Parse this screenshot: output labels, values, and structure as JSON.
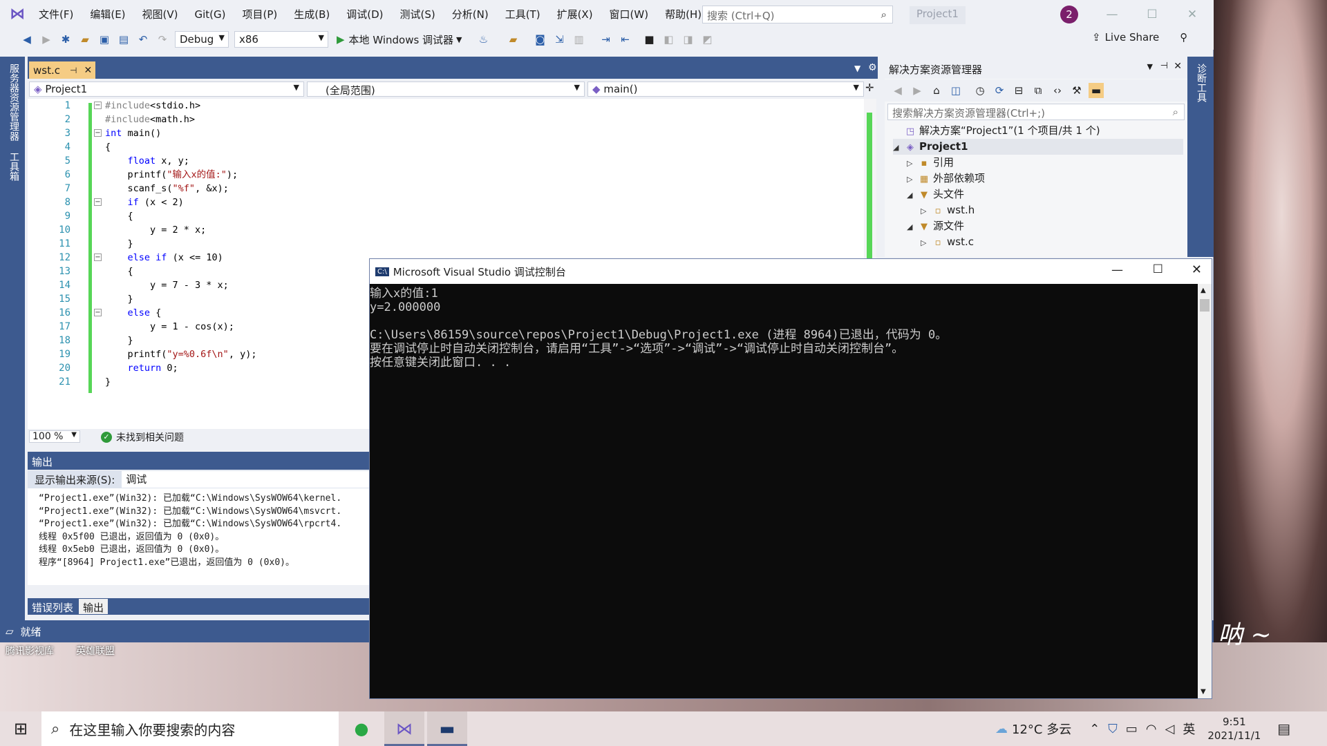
{
  "menu": [
    "文件(F)",
    "编辑(E)",
    "视图(V)",
    "Git(G)",
    "项目(P)",
    "生成(B)",
    "调试(D)",
    "测试(S)",
    "分析(N)",
    "工具(T)",
    "扩展(X)",
    "窗口(W)",
    "帮助(H)"
  ],
  "search": {
    "placeholder": "搜索 (Ctrl+Q)"
  },
  "project_title": "Project1",
  "notification_count": "2",
  "toolbar": {
    "config": "Debug",
    "platform": "x86",
    "run_label": "本地 Windows 调试器",
    "live_share": "Live Share"
  },
  "left_strip": [
    "服务器资源管理器",
    "工具箱"
  ],
  "right_strip": [
    "诊断工具"
  ],
  "doc_tab": "wst.c",
  "nav": {
    "project": "Project1",
    "scope": "(全局范围)",
    "member": "main()"
  },
  "editor": {
    "line_numbers": [
      "1",
      "2",
      "3",
      "4",
      "5",
      "6",
      "7",
      "8",
      "9",
      "10",
      "11",
      "12",
      "13",
      "14",
      "15",
      "16",
      "17",
      "18",
      "19",
      "20",
      "21"
    ],
    "lines": [
      "#include<stdio.h>",
      "#include<math.h>",
      "int main()",
      "{",
      "    float x, y;",
      "    printf(\"输入x的值:\");",
      "    scanf_s(\"%f\", &x);",
      "    if (x < 2)",
      "    {",
      "        y = 2 * x;",
      "    }",
      "    else if (x <= 10)",
      "    {",
      "        y = 7 - 3 * x;",
      "    }",
      "    else {",
      "        y = 1 - cos(x);",
      "    }",
      "    printf(\"y=%0.6f\\n\", y);",
      "    return 0;",
      "}"
    ]
  },
  "editor_status": {
    "zoom": "100 %",
    "issues": "未找到相关问题"
  },
  "output": {
    "title": "输出",
    "source_label": "显示输出来源(S):",
    "source_value": "调试",
    "lines": [
      "“Project1.exe”(Win32): 已加载“C:\\Windows\\SysWOW64\\kernel.",
      "“Project1.exe”(Win32): 已加载“C:\\Windows\\SysWOW64\\msvcrt.",
      "“Project1.exe”(Win32): 已加载“C:\\Windows\\SysWOW64\\rpcrt4.",
      "线程 0x5f00 已退出，返回值为 0 (0x0)。",
      "线程 0x5eb0 已退出，返回值为 0 (0x0)。",
      "程序“[8964] Project1.exe”已退出，返回值为 0 (0x0)。"
    ],
    "tabs": [
      "错误列表",
      "输出"
    ]
  },
  "solution_explorer": {
    "title": "解决方案资源管理器",
    "search_placeholder": "搜索解决方案资源管理器(Ctrl+;)",
    "tree": [
      {
        "label": "解决方案“Project1”(1 个项目/共 1 个)",
        "depth": 0,
        "tri": ""
      },
      {
        "label": "Project1",
        "depth": 0,
        "tri": "◢"
      },
      {
        "label": "引用",
        "depth": 1,
        "tri": "▷"
      },
      {
        "label": "外部依赖项",
        "depth": 1,
        "tri": "▷"
      },
      {
        "label": "头文件",
        "depth": 1,
        "tri": "◢"
      },
      {
        "label": "wst.h",
        "depth": 2,
        "tri": "▷"
      },
      {
        "label": "源文件",
        "depth": 1,
        "tri": "◢"
      },
      {
        "label": "wst.c",
        "depth": 2,
        "tri": "▷"
      }
    ]
  },
  "statusbar": {
    "text": "就绪"
  },
  "desktop_labels": [
    "腾讯影视库",
    "英雄联盟"
  ],
  "wallpaper_text": "呐 ~",
  "console": {
    "title": "Microsoft Visual Studio 调试控制台",
    "lines": [
      "输入x的值:1",
      "y=2.000000",
      "",
      "C:\\Users\\86159\\source\\repos\\Project1\\Debug\\Project1.exe (进程 8964)已退出，代码为 0。",
      "要在调试停止时自动关闭控制台，请启用“工具”->“选项”->“调试”->“调试停止时自动关闭控制台”。",
      "按任意键关闭此窗口. . ."
    ]
  },
  "taskbar": {
    "search_placeholder": "在这里输入你要搜索的内容",
    "weather": "12°C 多云",
    "ime": "英",
    "time": "9:51",
    "date": "2021/11/1"
  },
  "colors": {
    "accent": "#3d5a8f",
    "tab_active": "#f5cc84",
    "change_bar": "#57d657",
    "keyword": "#0000ff",
    "string": "#a31515"
  }
}
